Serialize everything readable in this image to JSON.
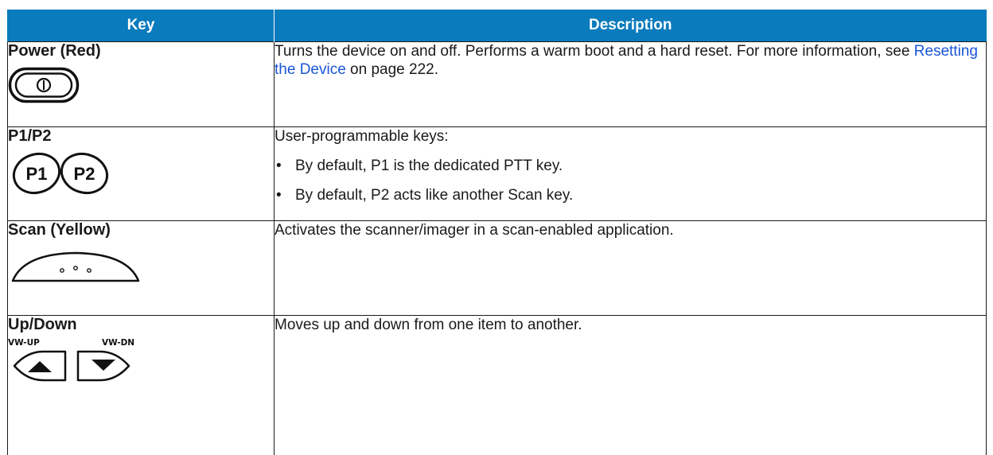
{
  "table": {
    "headers": {
      "key": "Key",
      "description": "Description"
    },
    "rows": [
      {
        "key_name": "Power (Red)",
        "icon": "power-button-icon",
        "description_parts": {
          "before_link": "Turns the device on and off. Performs a warm boot and a hard reset. For more information, see ",
          "link": "Resetting the Device",
          "after_link": " on page 222."
        }
      },
      {
        "key_name": "P1/P2",
        "icon": "p1-p2-keys-icon",
        "icon_labels": [
          "P1",
          "P2"
        ],
        "description_intro": "User-programmable keys:",
        "bullets": [
          "By default, P1 is the dedicated PTT key.",
          "By default, P2 acts like another Scan key."
        ],
        "bullet_glyph": "•"
      },
      {
        "key_name": "Scan (Yellow)",
        "icon": "scan-button-icon",
        "description": "Activates the scanner/imager in a scan-enabled application."
      },
      {
        "key_name": "Up/Down",
        "icon": "volume-up-down-icon",
        "icon_labels": [
          "VW-UP",
          "VW-DN"
        ],
        "description": "Moves up and down from one item to another."
      }
    ]
  },
  "colors": {
    "header_bg": "#0a7bbd",
    "header_text": "#ffffff",
    "link": "#1a55d8",
    "border": "#1a1a1a"
  }
}
